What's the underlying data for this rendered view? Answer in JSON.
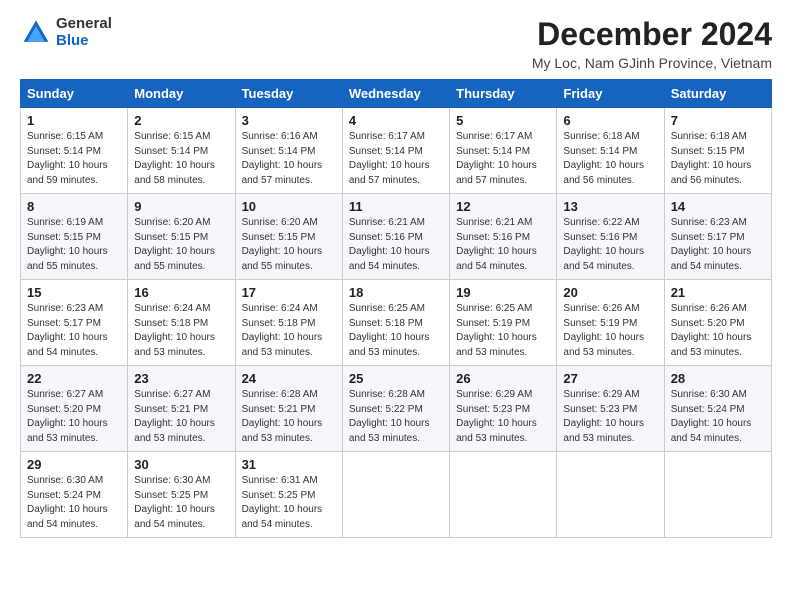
{
  "logo": {
    "general": "General",
    "blue": "Blue"
  },
  "title": "December 2024",
  "location": "My Loc, Nam GJinh Province, Vietnam",
  "weekdays": [
    "Sunday",
    "Monday",
    "Tuesday",
    "Wednesday",
    "Thursday",
    "Friday",
    "Saturday"
  ],
  "weeks": [
    [
      {
        "day": 1,
        "sunrise": "6:15 AM",
        "sunset": "5:14 PM",
        "daylight": "10 hours and 59 minutes."
      },
      {
        "day": 2,
        "sunrise": "6:15 AM",
        "sunset": "5:14 PM",
        "daylight": "10 hours and 58 minutes."
      },
      {
        "day": 3,
        "sunrise": "6:16 AM",
        "sunset": "5:14 PM",
        "daylight": "10 hours and 57 minutes."
      },
      {
        "day": 4,
        "sunrise": "6:17 AM",
        "sunset": "5:14 PM",
        "daylight": "10 hours and 57 minutes."
      },
      {
        "day": 5,
        "sunrise": "6:17 AM",
        "sunset": "5:14 PM",
        "daylight": "10 hours and 57 minutes."
      },
      {
        "day": 6,
        "sunrise": "6:18 AM",
        "sunset": "5:14 PM",
        "daylight": "10 hours and 56 minutes."
      },
      {
        "day": 7,
        "sunrise": "6:18 AM",
        "sunset": "5:15 PM",
        "daylight": "10 hours and 56 minutes."
      }
    ],
    [
      {
        "day": 8,
        "sunrise": "6:19 AM",
        "sunset": "5:15 PM",
        "daylight": "10 hours and 55 minutes."
      },
      {
        "day": 9,
        "sunrise": "6:20 AM",
        "sunset": "5:15 PM",
        "daylight": "10 hours and 55 minutes."
      },
      {
        "day": 10,
        "sunrise": "6:20 AM",
        "sunset": "5:15 PM",
        "daylight": "10 hours and 55 minutes."
      },
      {
        "day": 11,
        "sunrise": "6:21 AM",
        "sunset": "5:16 PM",
        "daylight": "10 hours and 54 minutes."
      },
      {
        "day": 12,
        "sunrise": "6:21 AM",
        "sunset": "5:16 PM",
        "daylight": "10 hours and 54 minutes."
      },
      {
        "day": 13,
        "sunrise": "6:22 AM",
        "sunset": "5:16 PM",
        "daylight": "10 hours and 54 minutes."
      },
      {
        "day": 14,
        "sunrise": "6:23 AM",
        "sunset": "5:17 PM",
        "daylight": "10 hours and 54 minutes."
      }
    ],
    [
      {
        "day": 15,
        "sunrise": "6:23 AM",
        "sunset": "5:17 PM",
        "daylight": "10 hours and 54 minutes."
      },
      {
        "day": 16,
        "sunrise": "6:24 AM",
        "sunset": "5:18 PM",
        "daylight": "10 hours and 53 minutes."
      },
      {
        "day": 17,
        "sunrise": "6:24 AM",
        "sunset": "5:18 PM",
        "daylight": "10 hours and 53 minutes."
      },
      {
        "day": 18,
        "sunrise": "6:25 AM",
        "sunset": "5:18 PM",
        "daylight": "10 hours and 53 minutes."
      },
      {
        "day": 19,
        "sunrise": "6:25 AM",
        "sunset": "5:19 PM",
        "daylight": "10 hours and 53 minutes."
      },
      {
        "day": 20,
        "sunrise": "6:26 AM",
        "sunset": "5:19 PM",
        "daylight": "10 hours and 53 minutes."
      },
      {
        "day": 21,
        "sunrise": "6:26 AM",
        "sunset": "5:20 PM",
        "daylight": "10 hours and 53 minutes."
      }
    ],
    [
      {
        "day": 22,
        "sunrise": "6:27 AM",
        "sunset": "5:20 PM",
        "daylight": "10 hours and 53 minutes."
      },
      {
        "day": 23,
        "sunrise": "6:27 AM",
        "sunset": "5:21 PM",
        "daylight": "10 hours and 53 minutes."
      },
      {
        "day": 24,
        "sunrise": "6:28 AM",
        "sunset": "5:21 PM",
        "daylight": "10 hours and 53 minutes."
      },
      {
        "day": 25,
        "sunrise": "6:28 AM",
        "sunset": "5:22 PM",
        "daylight": "10 hours and 53 minutes."
      },
      {
        "day": 26,
        "sunrise": "6:29 AM",
        "sunset": "5:23 PM",
        "daylight": "10 hours and 53 minutes."
      },
      {
        "day": 27,
        "sunrise": "6:29 AM",
        "sunset": "5:23 PM",
        "daylight": "10 hours and 53 minutes."
      },
      {
        "day": 28,
        "sunrise": "6:30 AM",
        "sunset": "5:24 PM",
        "daylight": "10 hours and 54 minutes."
      }
    ],
    [
      {
        "day": 29,
        "sunrise": "6:30 AM",
        "sunset": "5:24 PM",
        "daylight": "10 hours and 54 minutes."
      },
      {
        "day": 30,
        "sunrise": "6:30 AM",
        "sunset": "5:25 PM",
        "daylight": "10 hours and 54 minutes."
      },
      {
        "day": 31,
        "sunrise": "6:31 AM",
        "sunset": "5:25 PM",
        "daylight": "10 hours and 54 minutes."
      },
      null,
      null,
      null,
      null
    ]
  ]
}
